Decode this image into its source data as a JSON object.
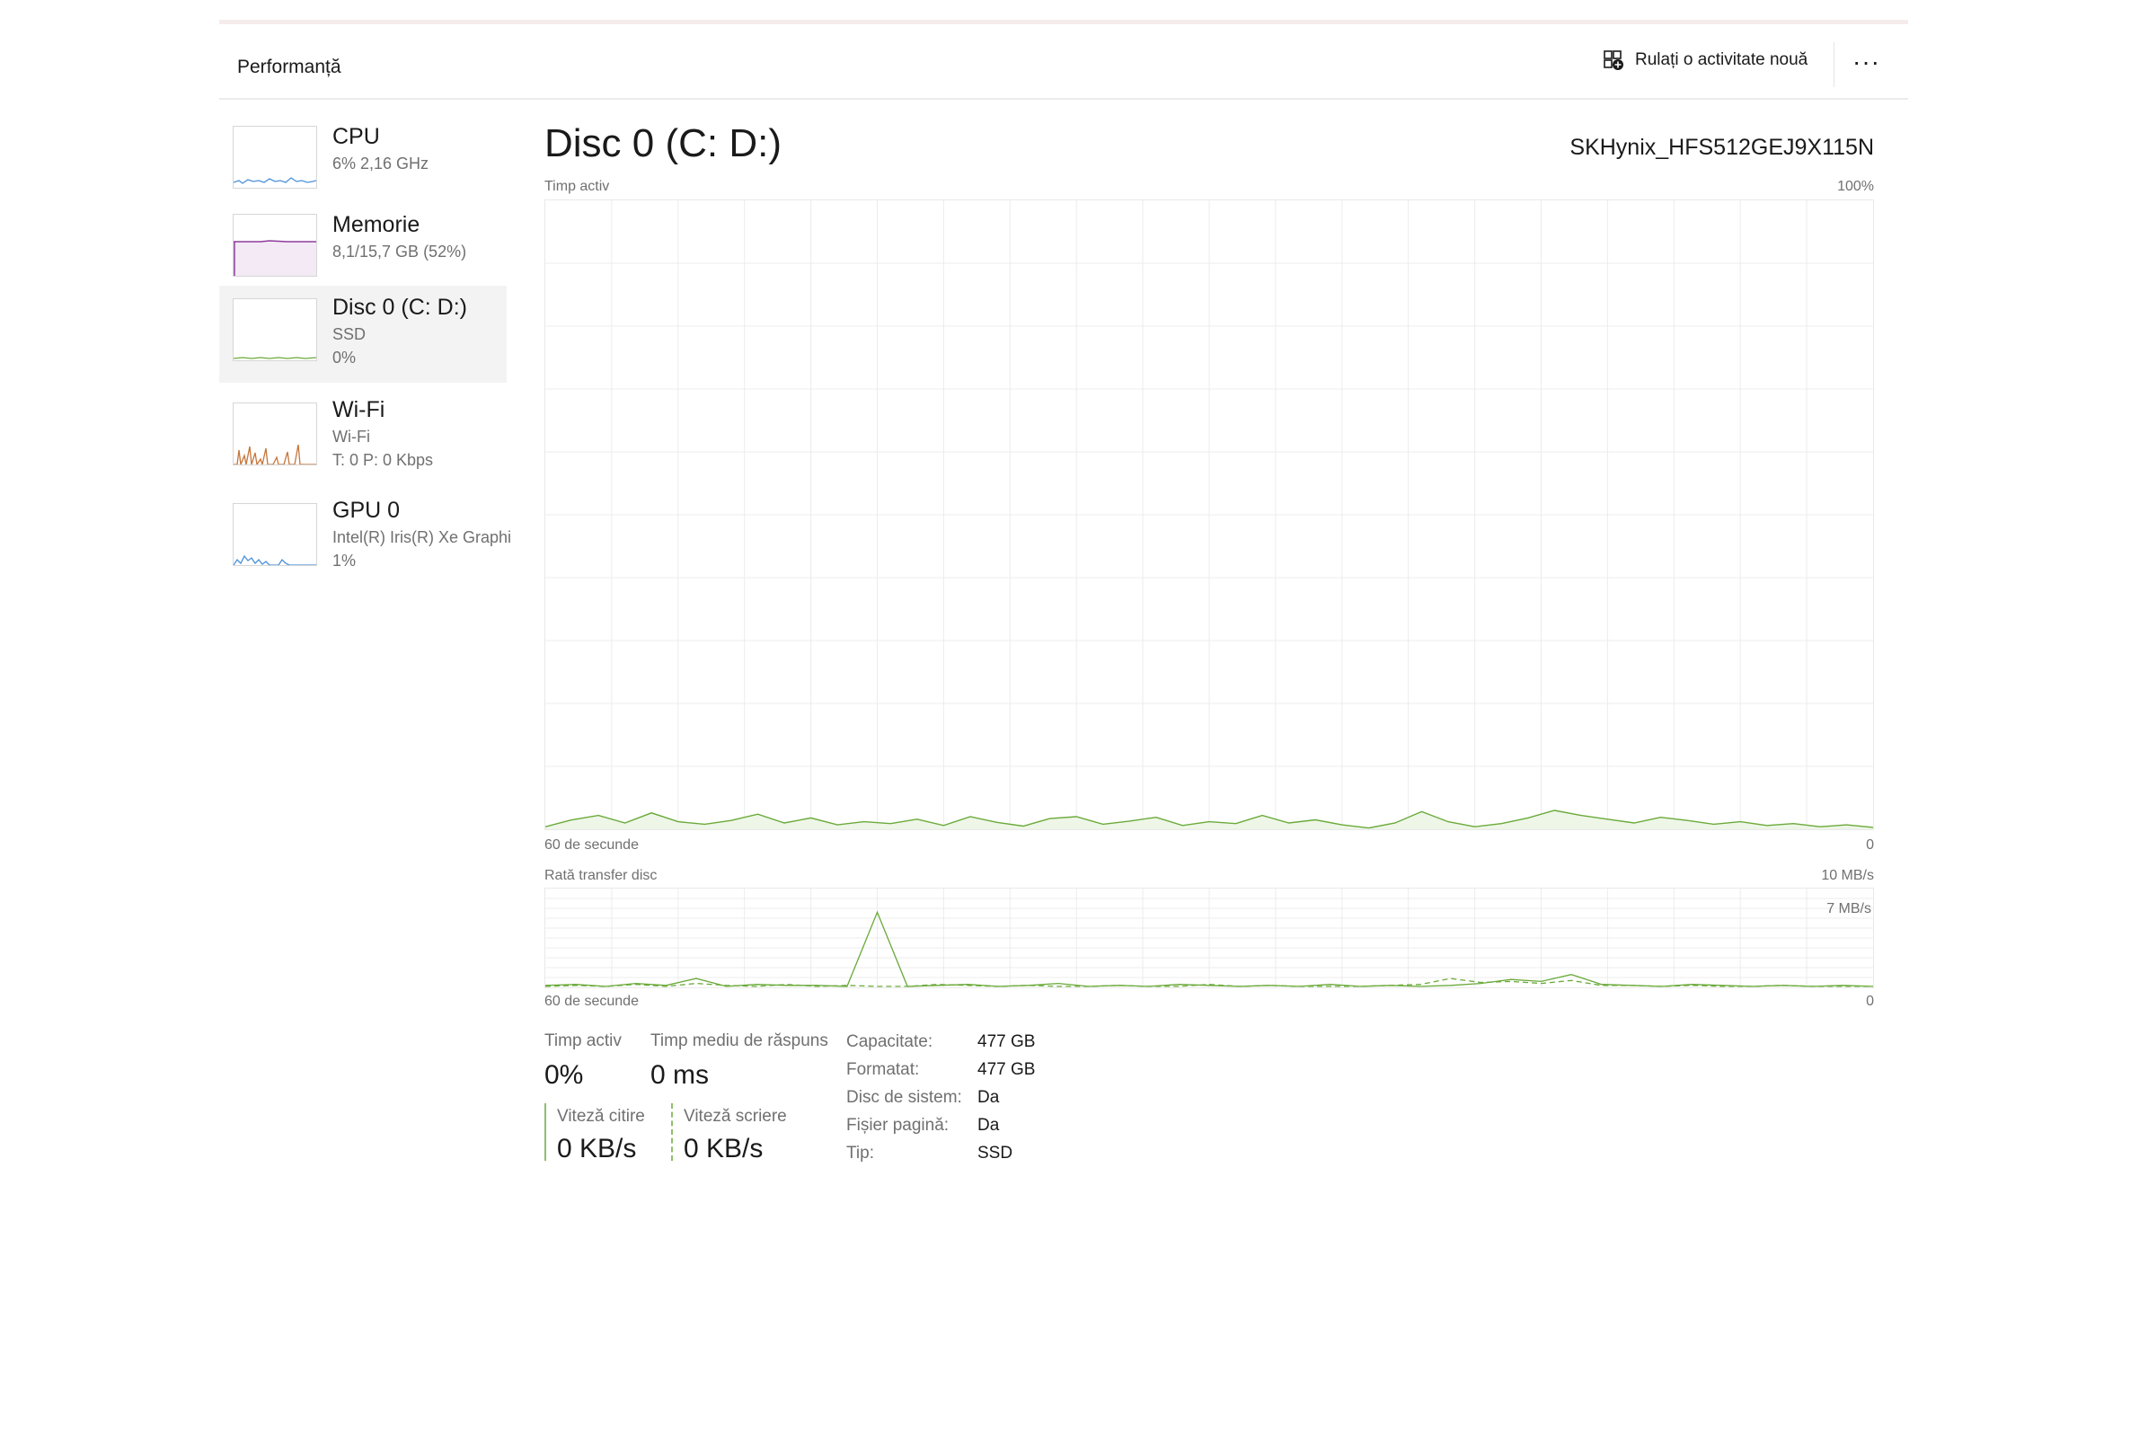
{
  "header": {
    "title": "Performanță",
    "run_task_label": "Rulați o activitate nouă",
    "more_label": "···"
  },
  "sidebar": {
    "items": [
      {
        "name": "CPU",
        "sub1": "6% 2,16 GHz",
        "sub2": ""
      },
      {
        "name": "Memorie",
        "sub1": "8,1/15,7 GB (52%)",
        "sub2": ""
      },
      {
        "name": "Disc 0 (C: D:)",
        "sub1": "SSD",
        "sub2": "0%"
      },
      {
        "name": "Wi-Fi",
        "sub1": "Wi-Fi",
        "sub2": "T: 0 P: 0 Kbps"
      },
      {
        "name": "GPU 0",
        "sub1": "Intel(R) Iris(R) Xe Graphi",
        "sub2": "1%"
      }
    ],
    "selected_index": 2,
    "colors": {
      "cpu": "#4a90d9",
      "memory": "#8e3c9c",
      "disk": "#6aaa3a",
      "wifi": "#c5763a",
      "gpu": "#4a90d9"
    }
  },
  "main": {
    "title": "Disc 0 (C: D:)",
    "model": "SKHynix_HFS512GEJ9X115N",
    "active_graph": {
      "label": "Timp activ",
      "max_label": "100%",
      "time_label": "60 de secunde",
      "min_label": "0",
      "values_percent": [
        0.4,
        1.5,
        2.2,
        1.0,
        2.6,
        1.2,
        0.8,
        1.4,
        2.4,
        1.0,
        1.8,
        0.7,
        1.2,
        0.9,
        1.6,
        0.6,
        2.0,
        1.1,
        0.5,
        1.7,
        2.0,
        0.8,
        1.3,
        1.9,
        0.6,
        1.2,
        0.9,
        2.2,
        1.0,
        1.5,
        0.7,
        0.2,
        1.0,
        2.8,
        1.2,
        0.4,
        0.9,
        1.8,
        3.0,
        2.2,
        1.6,
        1.0,
        1.9,
        1.4,
        0.8,
        1.2,
        0.6,
        0.9,
        0.4,
        0.7,
        0.3
      ]
    },
    "transfer_graph": {
      "label": "Rată transfer disc",
      "max_label": "10 MB/s",
      "secondary_label": "7 MB/s",
      "time_label": "60 de secunde",
      "min_label": "0",
      "read_mbs": [
        0.2,
        0.3,
        0.1,
        0.4,
        0.2,
        0.9,
        0.1,
        0.3,
        0.2,
        0.2,
        0.1,
        7.6,
        0.1,
        0.2,
        0.3,
        0.1,
        0.2,
        0.4,
        0.1,
        0.2,
        0.1,
        0.3,
        0.2,
        0.1,
        0.2,
        0.1,
        0.3,
        0.1,
        0.2,
        0.1,
        0.2,
        0.4,
        0.8,
        0.6,
        1.3,
        0.3,
        0.2,
        0.1,
        0.3,
        0.2,
        0.1,
        0.2,
        0.1,
        0.2,
        0.1
      ],
      "write_mbs": [
        0.1,
        0.2,
        0.1,
        0.3,
        0.1,
        0.4,
        0.2,
        0.1,
        0.3,
        0.1,
        0.2,
        0.1,
        0.1,
        0.3,
        0.2,
        0.1,
        0.2,
        0.1,
        0.1,
        0.2,
        0.1,
        0.1,
        0.3,
        0.1,
        0.2,
        0.1,
        0.1,
        0.1,
        0.2,
        0.3,
        0.9,
        0.5,
        0.6,
        0.4,
        0.7,
        0.2,
        0.2,
        0.1,
        0.2,
        0.1,
        0.1,
        0.2,
        0.1,
        0.1,
        0.1
      ]
    },
    "stats": {
      "active_time_label": "Timp activ",
      "active_time_value": "0%",
      "avg_response_label": "Timp mediu de răspuns",
      "avg_response_value": "0 ms",
      "read_speed_label": "Viteză citire",
      "read_speed_value": "0 KB/s",
      "write_speed_label": "Viteză scriere",
      "write_speed_value": "0 KB/s"
    },
    "properties": [
      {
        "key": "Capacitate:",
        "value": "477 GB"
      },
      {
        "key": "Formatat:",
        "value": "477 GB"
      },
      {
        "key": "Disc de sistem:",
        "value": "Da"
      },
      {
        "key": "Fișier pagină:",
        "value": "Da"
      },
      {
        "key": "Tip:",
        "value": "SSD"
      }
    ],
    "graph_color": "#6aaa3a"
  }
}
